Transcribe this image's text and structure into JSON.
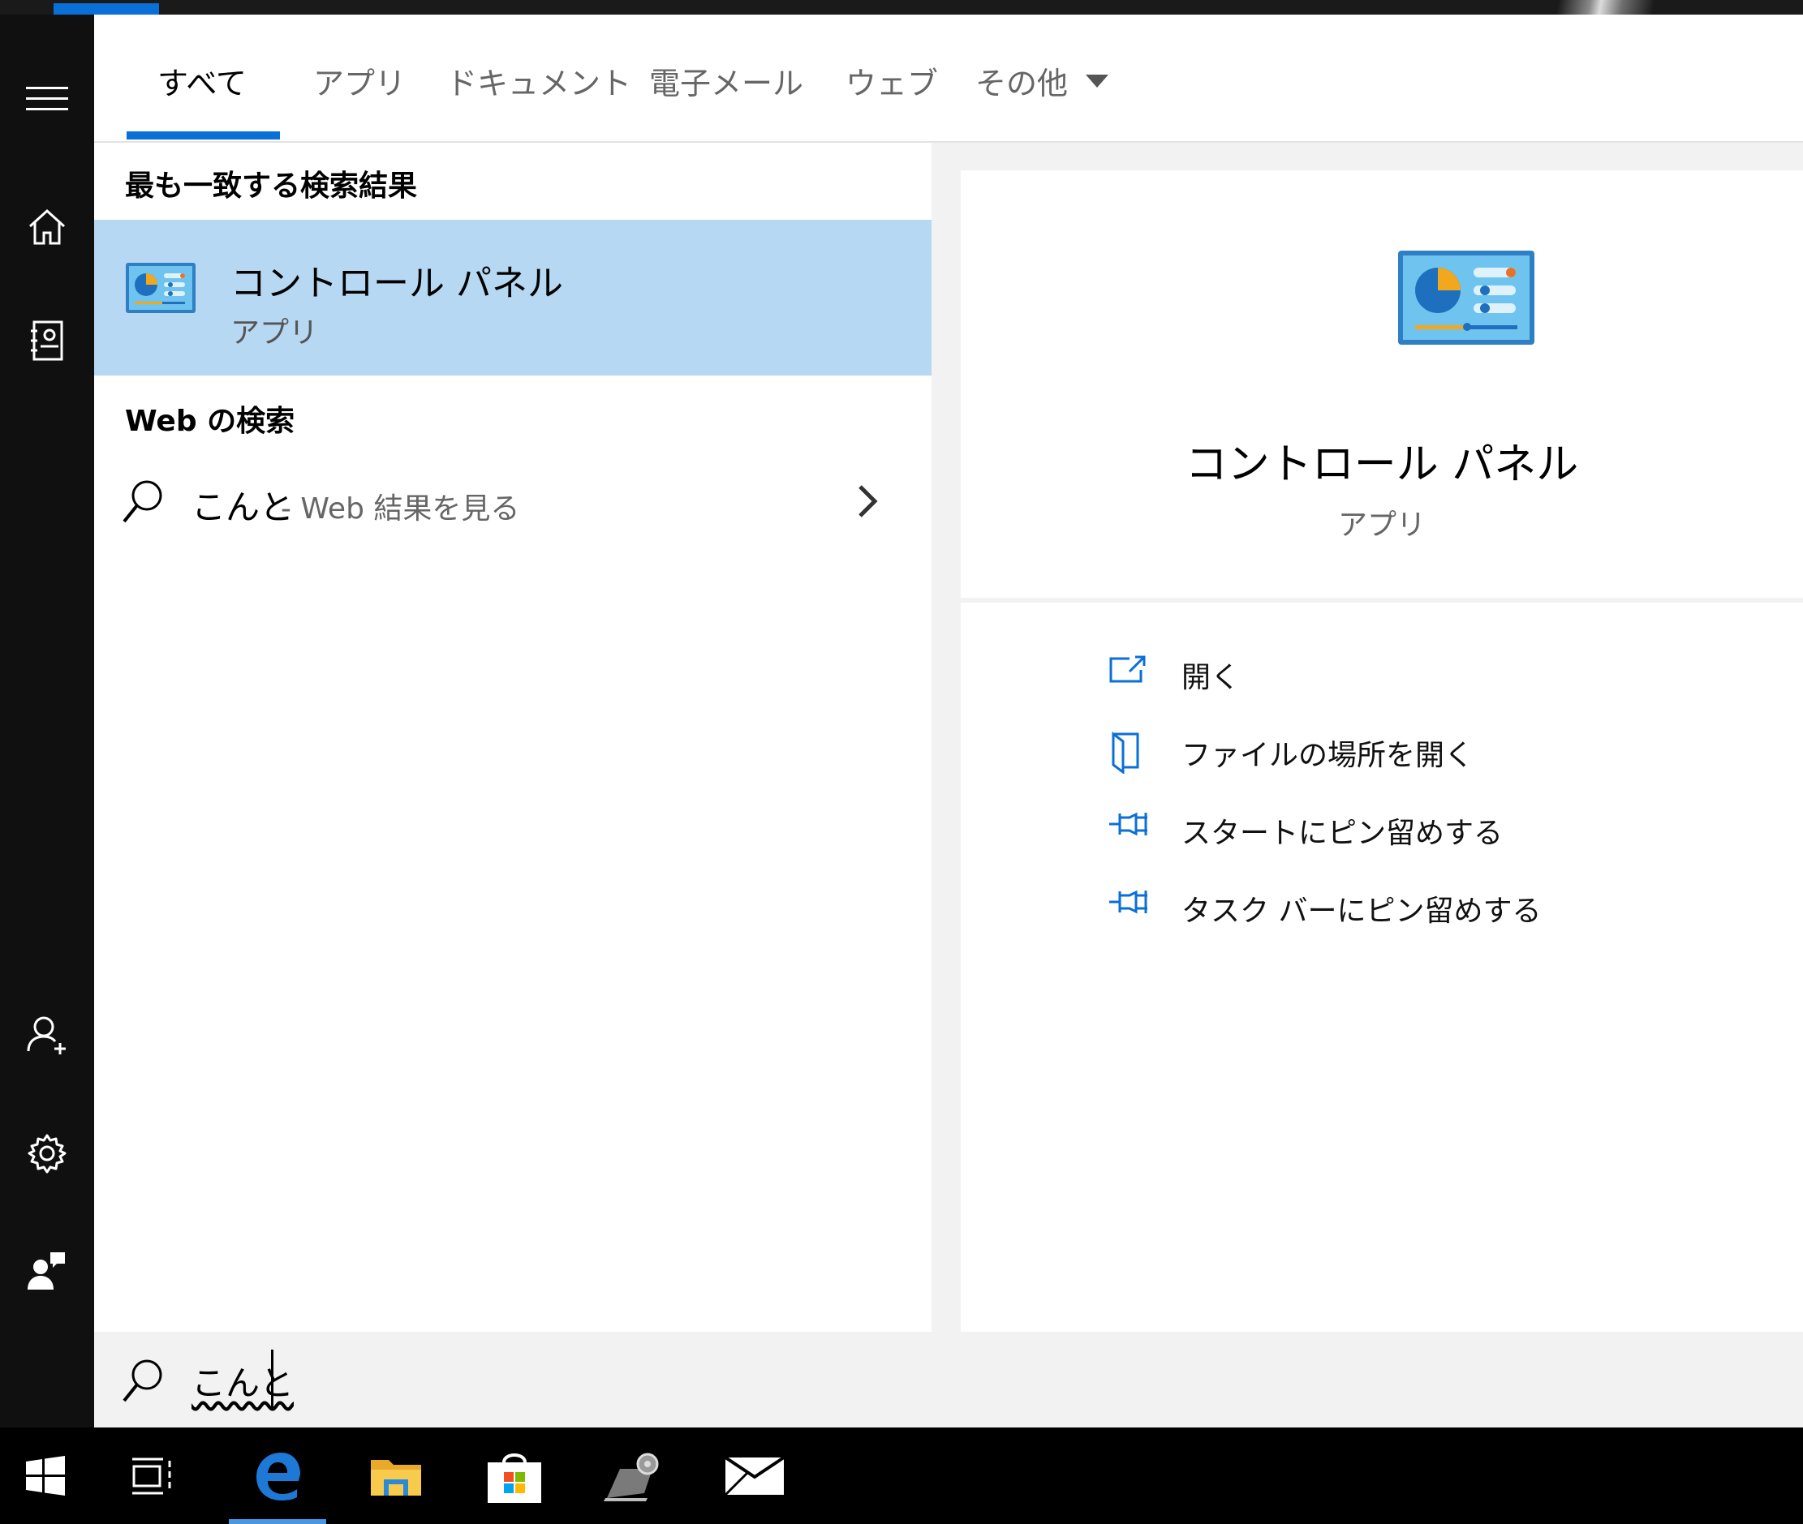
{
  "tabs": [
    {
      "label": "すべて",
      "active": true
    },
    {
      "label": "アプリ"
    },
    {
      "label": "ドキュメント"
    },
    {
      "label": "電子メール"
    },
    {
      "label": "ウェブ"
    },
    {
      "label": "その他"
    }
  ],
  "best_match": {
    "section_title": "最も一致する検索結果",
    "name": "コントロール パネル",
    "type": "アプリ"
  },
  "web": {
    "section_title": "Web の検索",
    "query": "こんと",
    "suffix": "- Web 結果を見る"
  },
  "detail": {
    "name": "コントロール パネル",
    "type": "アプリ",
    "actions": [
      {
        "label": "開く",
        "icon": "open-icon"
      },
      {
        "label": "ファイルの場所を開く",
        "icon": "file-location-icon"
      },
      {
        "label": "スタートにピン留めする",
        "icon": "pin-icon"
      },
      {
        "label": "タスク バーにピン留めする",
        "icon": "pin-icon"
      }
    ]
  },
  "search": {
    "value": "こんと"
  },
  "colors": {
    "accent": "#0a6fd6",
    "selection": "#b6d8f2",
    "rail": "#101010"
  },
  "rail_icons": [
    "hamburger-menu-icon",
    "home-icon",
    "notebook-icon",
    "account-icon",
    "settings-icon",
    "feedback-icon"
  ],
  "taskbar_icons": [
    "windows-start-icon",
    "task-view-icon",
    "edge-browser-icon",
    "file-explorer-icon",
    "store-icon",
    "settings-app-icon",
    "mail-icon"
  ]
}
